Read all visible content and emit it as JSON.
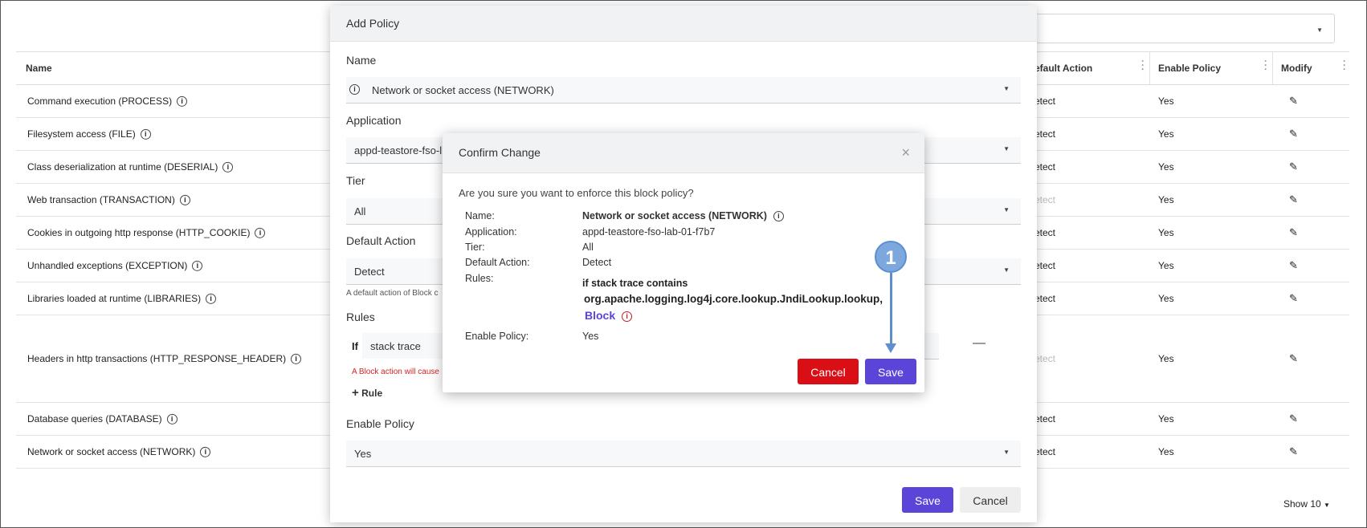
{
  "table": {
    "headers": {
      "name": "Name",
      "default_action": "efault Action",
      "enable_policy": "Enable Policy",
      "modify": "Modify"
    },
    "rows": [
      {
        "name": "Command execution (PROCESS)",
        "action": "etect",
        "enable": "Yes"
      },
      {
        "name": "Filesystem access (FILE)",
        "action": "etect",
        "enable": "Yes"
      },
      {
        "name": "Class deserialization at runtime (DESERIAL)",
        "action": "etect",
        "enable": "Yes"
      },
      {
        "name": "Web transaction (TRANSACTION)",
        "action": "etect",
        "enable": "Yes"
      },
      {
        "name": "Cookies in outgoing http response (HTTP_COOKIE)",
        "action": "etect",
        "enable": "Yes"
      },
      {
        "name": "Unhandled exceptions (EXCEPTION)",
        "action": "etect",
        "enable": "Yes"
      },
      {
        "name": "Libraries loaded at runtime (LIBRARIES)",
        "action": "etect",
        "enable": "Yes"
      },
      {
        "name": "Headers in http transactions (HTTP_RESPONSE_HEADER)",
        "action": "etect",
        "enable": "Yes"
      },
      {
        "name": "Database queries (DATABASE)",
        "action": "etect",
        "enable": "Yes"
      },
      {
        "name": "Network or socket access (NETWORK)",
        "action": "etect",
        "enable": "Yes"
      }
    ],
    "show_count": "Show 10"
  },
  "add_policy": {
    "title": "Add Policy",
    "name_label": "Name",
    "name_value": "Network or socket access (NETWORK)",
    "application_label": "Application",
    "application_value": "appd-teastore-fso-l",
    "tier_label": "Tier",
    "tier_value": "All",
    "default_action_label": "Default Action",
    "default_action_value": "Detect",
    "default_action_hint": "A default action of Block c",
    "rules_label": "Rules",
    "rule_if": "If",
    "rule_field": "stack trace",
    "rule_warning": "A Block action will cause",
    "add_rule": "Rule",
    "enable_policy_label": "Enable Policy",
    "enable_policy_value": "Yes",
    "save": "Save",
    "cancel": "Cancel"
  },
  "confirm": {
    "title": "Confirm Change",
    "question": "Are you sure you want to enforce this block policy?",
    "name_label": "Name:",
    "name_value": "Network or socket access (NETWORK)",
    "application_label": "Application:",
    "application_value": "appd-teastore-fso-lab-01-f7b7",
    "tier_label": "Tier:",
    "tier_value": "All",
    "default_action_label": "Default Action:",
    "default_action_value": "Detect",
    "rules_label": "Rules:",
    "rule_line1": "if stack trace contains",
    "rule_line2": "org.apache.logging.log4j.core.lookup.JndiLookup.lookup,",
    "rule_action": "Block",
    "enable_policy_label": "Enable Policy:",
    "enable_policy_value": "Yes",
    "cancel": "Cancel",
    "save": "Save"
  },
  "callout": {
    "number": "1"
  },
  "colors": {
    "primary": "#5a45d8",
    "danger": "#d90f15",
    "callout": "#7ca8dd"
  }
}
